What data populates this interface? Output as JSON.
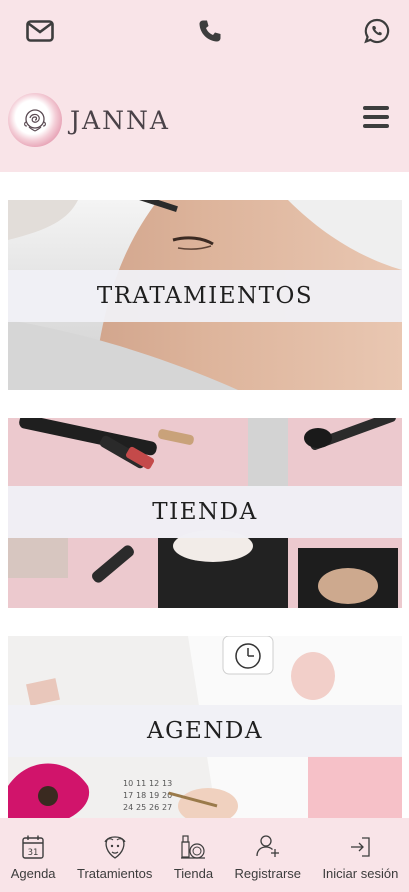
{
  "header": {
    "brand_name": "JANNA",
    "contact_icons": [
      "mail-icon",
      "phone-icon",
      "whatsapp-icon"
    ],
    "menu_icon": "hamburger-icon",
    "background": "#f9e4e8"
  },
  "cards": [
    {
      "label": "TRATAMIENTOS",
      "image": "facial-treatment-photo"
    },
    {
      "label": "TIENDA",
      "image": "makeup-products-photo"
    },
    {
      "label": "AGENDA",
      "image": "calendar-planner-photo"
    }
  ],
  "bottom_nav": {
    "items": [
      {
        "label": "Agenda",
        "icon": "calendar-31-icon",
        "calendar_day": "31"
      },
      {
        "label": "Tratamientos",
        "icon": "face-mask-icon"
      },
      {
        "label": "Tienda",
        "icon": "makeup-icon"
      },
      {
        "label": "Registrarse",
        "icon": "add-user-icon"
      },
      {
        "label": "Iniciar sesión",
        "icon": "login-icon"
      }
    ]
  }
}
